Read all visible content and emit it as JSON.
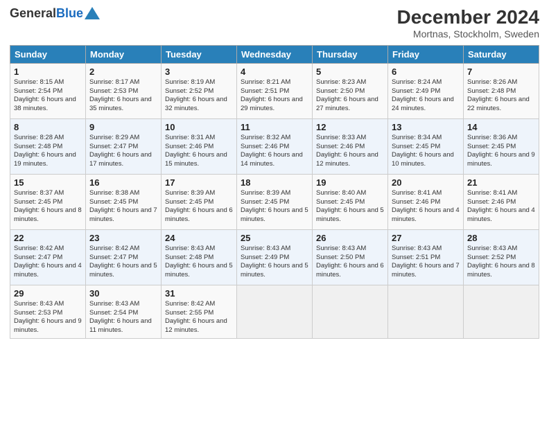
{
  "header": {
    "logo_general": "General",
    "logo_blue": "Blue",
    "month_year": "December 2024",
    "location": "Mortnas, Stockholm, Sweden"
  },
  "weekdays": [
    "Sunday",
    "Monday",
    "Tuesday",
    "Wednesday",
    "Thursday",
    "Friday",
    "Saturday"
  ],
  "rows": [
    [
      {
        "day": "1",
        "sunrise": "Sunrise: 8:15 AM",
        "sunset": "Sunset: 2:54 PM",
        "daylight": "Daylight: 6 hours and 38 minutes."
      },
      {
        "day": "2",
        "sunrise": "Sunrise: 8:17 AM",
        "sunset": "Sunset: 2:53 PM",
        "daylight": "Daylight: 6 hours and 35 minutes."
      },
      {
        "day": "3",
        "sunrise": "Sunrise: 8:19 AM",
        "sunset": "Sunset: 2:52 PM",
        "daylight": "Daylight: 6 hours and 32 minutes."
      },
      {
        "day": "4",
        "sunrise": "Sunrise: 8:21 AM",
        "sunset": "Sunset: 2:51 PM",
        "daylight": "Daylight: 6 hours and 29 minutes."
      },
      {
        "day": "5",
        "sunrise": "Sunrise: 8:23 AM",
        "sunset": "Sunset: 2:50 PM",
        "daylight": "Daylight: 6 hours and 27 minutes."
      },
      {
        "day": "6",
        "sunrise": "Sunrise: 8:24 AM",
        "sunset": "Sunset: 2:49 PM",
        "daylight": "Daylight: 6 hours and 24 minutes."
      },
      {
        "day": "7",
        "sunrise": "Sunrise: 8:26 AM",
        "sunset": "Sunset: 2:48 PM",
        "daylight": "Daylight: 6 hours and 22 minutes."
      }
    ],
    [
      {
        "day": "8",
        "sunrise": "Sunrise: 8:28 AM",
        "sunset": "Sunset: 2:48 PM",
        "daylight": "Daylight: 6 hours and 19 minutes."
      },
      {
        "day": "9",
        "sunrise": "Sunrise: 8:29 AM",
        "sunset": "Sunset: 2:47 PM",
        "daylight": "Daylight: 6 hours and 17 minutes."
      },
      {
        "day": "10",
        "sunrise": "Sunrise: 8:31 AM",
        "sunset": "Sunset: 2:46 PM",
        "daylight": "Daylight: 6 hours and 15 minutes."
      },
      {
        "day": "11",
        "sunrise": "Sunrise: 8:32 AM",
        "sunset": "Sunset: 2:46 PM",
        "daylight": "Daylight: 6 hours and 14 minutes."
      },
      {
        "day": "12",
        "sunrise": "Sunrise: 8:33 AM",
        "sunset": "Sunset: 2:46 PM",
        "daylight": "Daylight: 6 hours and 12 minutes."
      },
      {
        "day": "13",
        "sunrise": "Sunrise: 8:34 AM",
        "sunset": "Sunset: 2:45 PM",
        "daylight": "Daylight: 6 hours and 10 minutes."
      },
      {
        "day": "14",
        "sunrise": "Sunrise: 8:36 AM",
        "sunset": "Sunset: 2:45 PM",
        "daylight": "Daylight: 6 hours and 9 minutes."
      }
    ],
    [
      {
        "day": "15",
        "sunrise": "Sunrise: 8:37 AM",
        "sunset": "Sunset: 2:45 PM",
        "daylight": "Daylight: 6 hours and 8 minutes."
      },
      {
        "day": "16",
        "sunrise": "Sunrise: 8:38 AM",
        "sunset": "Sunset: 2:45 PM",
        "daylight": "Daylight: 6 hours and 7 minutes."
      },
      {
        "day": "17",
        "sunrise": "Sunrise: 8:39 AM",
        "sunset": "Sunset: 2:45 PM",
        "daylight": "Daylight: 6 hours and 6 minutes."
      },
      {
        "day": "18",
        "sunrise": "Sunrise: 8:39 AM",
        "sunset": "Sunset: 2:45 PM",
        "daylight": "Daylight: 6 hours and 5 minutes."
      },
      {
        "day": "19",
        "sunrise": "Sunrise: 8:40 AM",
        "sunset": "Sunset: 2:45 PM",
        "daylight": "Daylight: 6 hours and 5 minutes."
      },
      {
        "day": "20",
        "sunrise": "Sunrise: 8:41 AM",
        "sunset": "Sunset: 2:46 PM",
        "daylight": "Daylight: 6 hours and 4 minutes."
      },
      {
        "day": "21",
        "sunrise": "Sunrise: 8:41 AM",
        "sunset": "Sunset: 2:46 PM",
        "daylight": "Daylight: 6 hours and 4 minutes."
      }
    ],
    [
      {
        "day": "22",
        "sunrise": "Sunrise: 8:42 AM",
        "sunset": "Sunset: 2:47 PM",
        "daylight": "Daylight: 6 hours and 4 minutes."
      },
      {
        "day": "23",
        "sunrise": "Sunrise: 8:42 AM",
        "sunset": "Sunset: 2:47 PM",
        "daylight": "Daylight: 6 hours and 5 minutes."
      },
      {
        "day": "24",
        "sunrise": "Sunrise: 8:43 AM",
        "sunset": "Sunset: 2:48 PM",
        "daylight": "Daylight: 6 hours and 5 minutes."
      },
      {
        "day": "25",
        "sunrise": "Sunrise: 8:43 AM",
        "sunset": "Sunset: 2:49 PM",
        "daylight": "Daylight: 6 hours and 5 minutes."
      },
      {
        "day": "26",
        "sunrise": "Sunrise: 8:43 AM",
        "sunset": "Sunset: 2:50 PM",
        "daylight": "Daylight: 6 hours and 6 minutes."
      },
      {
        "day": "27",
        "sunrise": "Sunrise: 8:43 AM",
        "sunset": "Sunset: 2:51 PM",
        "daylight": "Daylight: 6 hours and 7 minutes."
      },
      {
        "day": "28",
        "sunrise": "Sunrise: 8:43 AM",
        "sunset": "Sunset: 2:52 PM",
        "daylight": "Daylight: 6 hours and 8 minutes."
      }
    ],
    [
      {
        "day": "29",
        "sunrise": "Sunrise: 8:43 AM",
        "sunset": "Sunset: 2:53 PM",
        "daylight": "Daylight: 6 hours and 9 minutes."
      },
      {
        "day": "30",
        "sunrise": "Sunrise: 8:43 AM",
        "sunset": "Sunset: 2:54 PM",
        "daylight": "Daylight: 6 hours and 11 minutes."
      },
      {
        "day": "31",
        "sunrise": "Sunrise: 8:42 AM",
        "sunset": "Sunset: 2:55 PM",
        "daylight": "Daylight: 6 hours and 12 minutes."
      },
      null,
      null,
      null,
      null
    ]
  ]
}
